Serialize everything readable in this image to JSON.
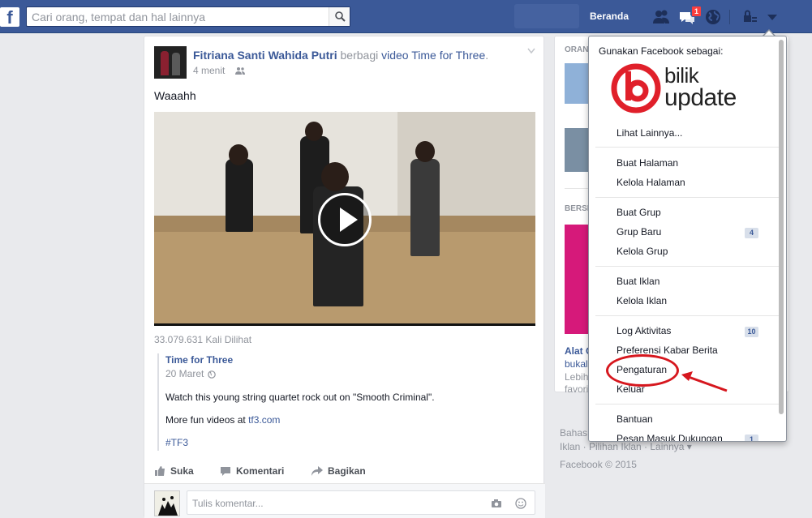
{
  "topbar": {
    "logo": "f",
    "search_placeholder": "Cari orang, tempat dan hal lainnya",
    "home_label": "Beranda",
    "notification_count": "1"
  },
  "post": {
    "author": "Fitriana Santi Wahida Putri",
    "action": "berbagi",
    "link_text": "video Time for Three",
    "period": ".",
    "time": "4 menit",
    "text": "Waaahh",
    "views": "33.079.631 Kali Dilihat",
    "shared": {
      "title": "Time for Three",
      "date": "20 Maret",
      "line1": "Watch this young string quartet rock out on \"Smooth Criminal\".",
      "line2_prefix": "More fun videos at ",
      "line2_link": "tf3.com",
      "hashtag": "#TF3"
    },
    "actions": {
      "like": "Suka",
      "comment": "Komentari",
      "share": "Bagikan"
    },
    "comment_placeholder": "Tulis komentar..."
  },
  "right_column": {
    "section1": "ORANG",
    "section2": "BERSP",
    "ad_title": "Alat C",
    "ad_sub1": "bukal",
    "ad_sub2": "Lebih",
    "ad_sub3": "favorit"
  },
  "footer": {
    "line1": "Bahas",
    "line2": "Iklan · Pilihan Iklan  · Lainnya ▾",
    "copyright": "Facebook © 2015"
  },
  "dropdown": {
    "use_as": "Gunakan Facebook sebagai:",
    "brand_line1": "bilik",
    "brand_line2": "update",
    "see_more": "Lihat Lainnya...",
    "items": {
      "create_page": "Buat Halaman",
      "manage_pages": "Kelola Halaman",
      "create_group": "Buat Grup",
      "new_groups": "Grup Baru",
      "new_groups_count": "4",
      "manage_groups": "Kelola Grup",
      "create_ad": "Buat Iklan",
      "manage_ads": "Kelola Iklan",
      "activity_log": "Log Aktivitas",
      "activity_log_count": "10",
      "news_feed_prefs": "Preferensi Kabar Berita",
      "settings": "Pengaturan",
      "logout": "Keluar",
      "help": "Bantuan",
      "support_inbox": "Pesan Masuk Dukungan",
      "support_inbox_count": "1"
    }
  },
  "colors": {
    "facebook_blue": "#3b5998",
    "highlight_red": "#d6171e",
    "brand_red": "#e0202a"
  }
}
